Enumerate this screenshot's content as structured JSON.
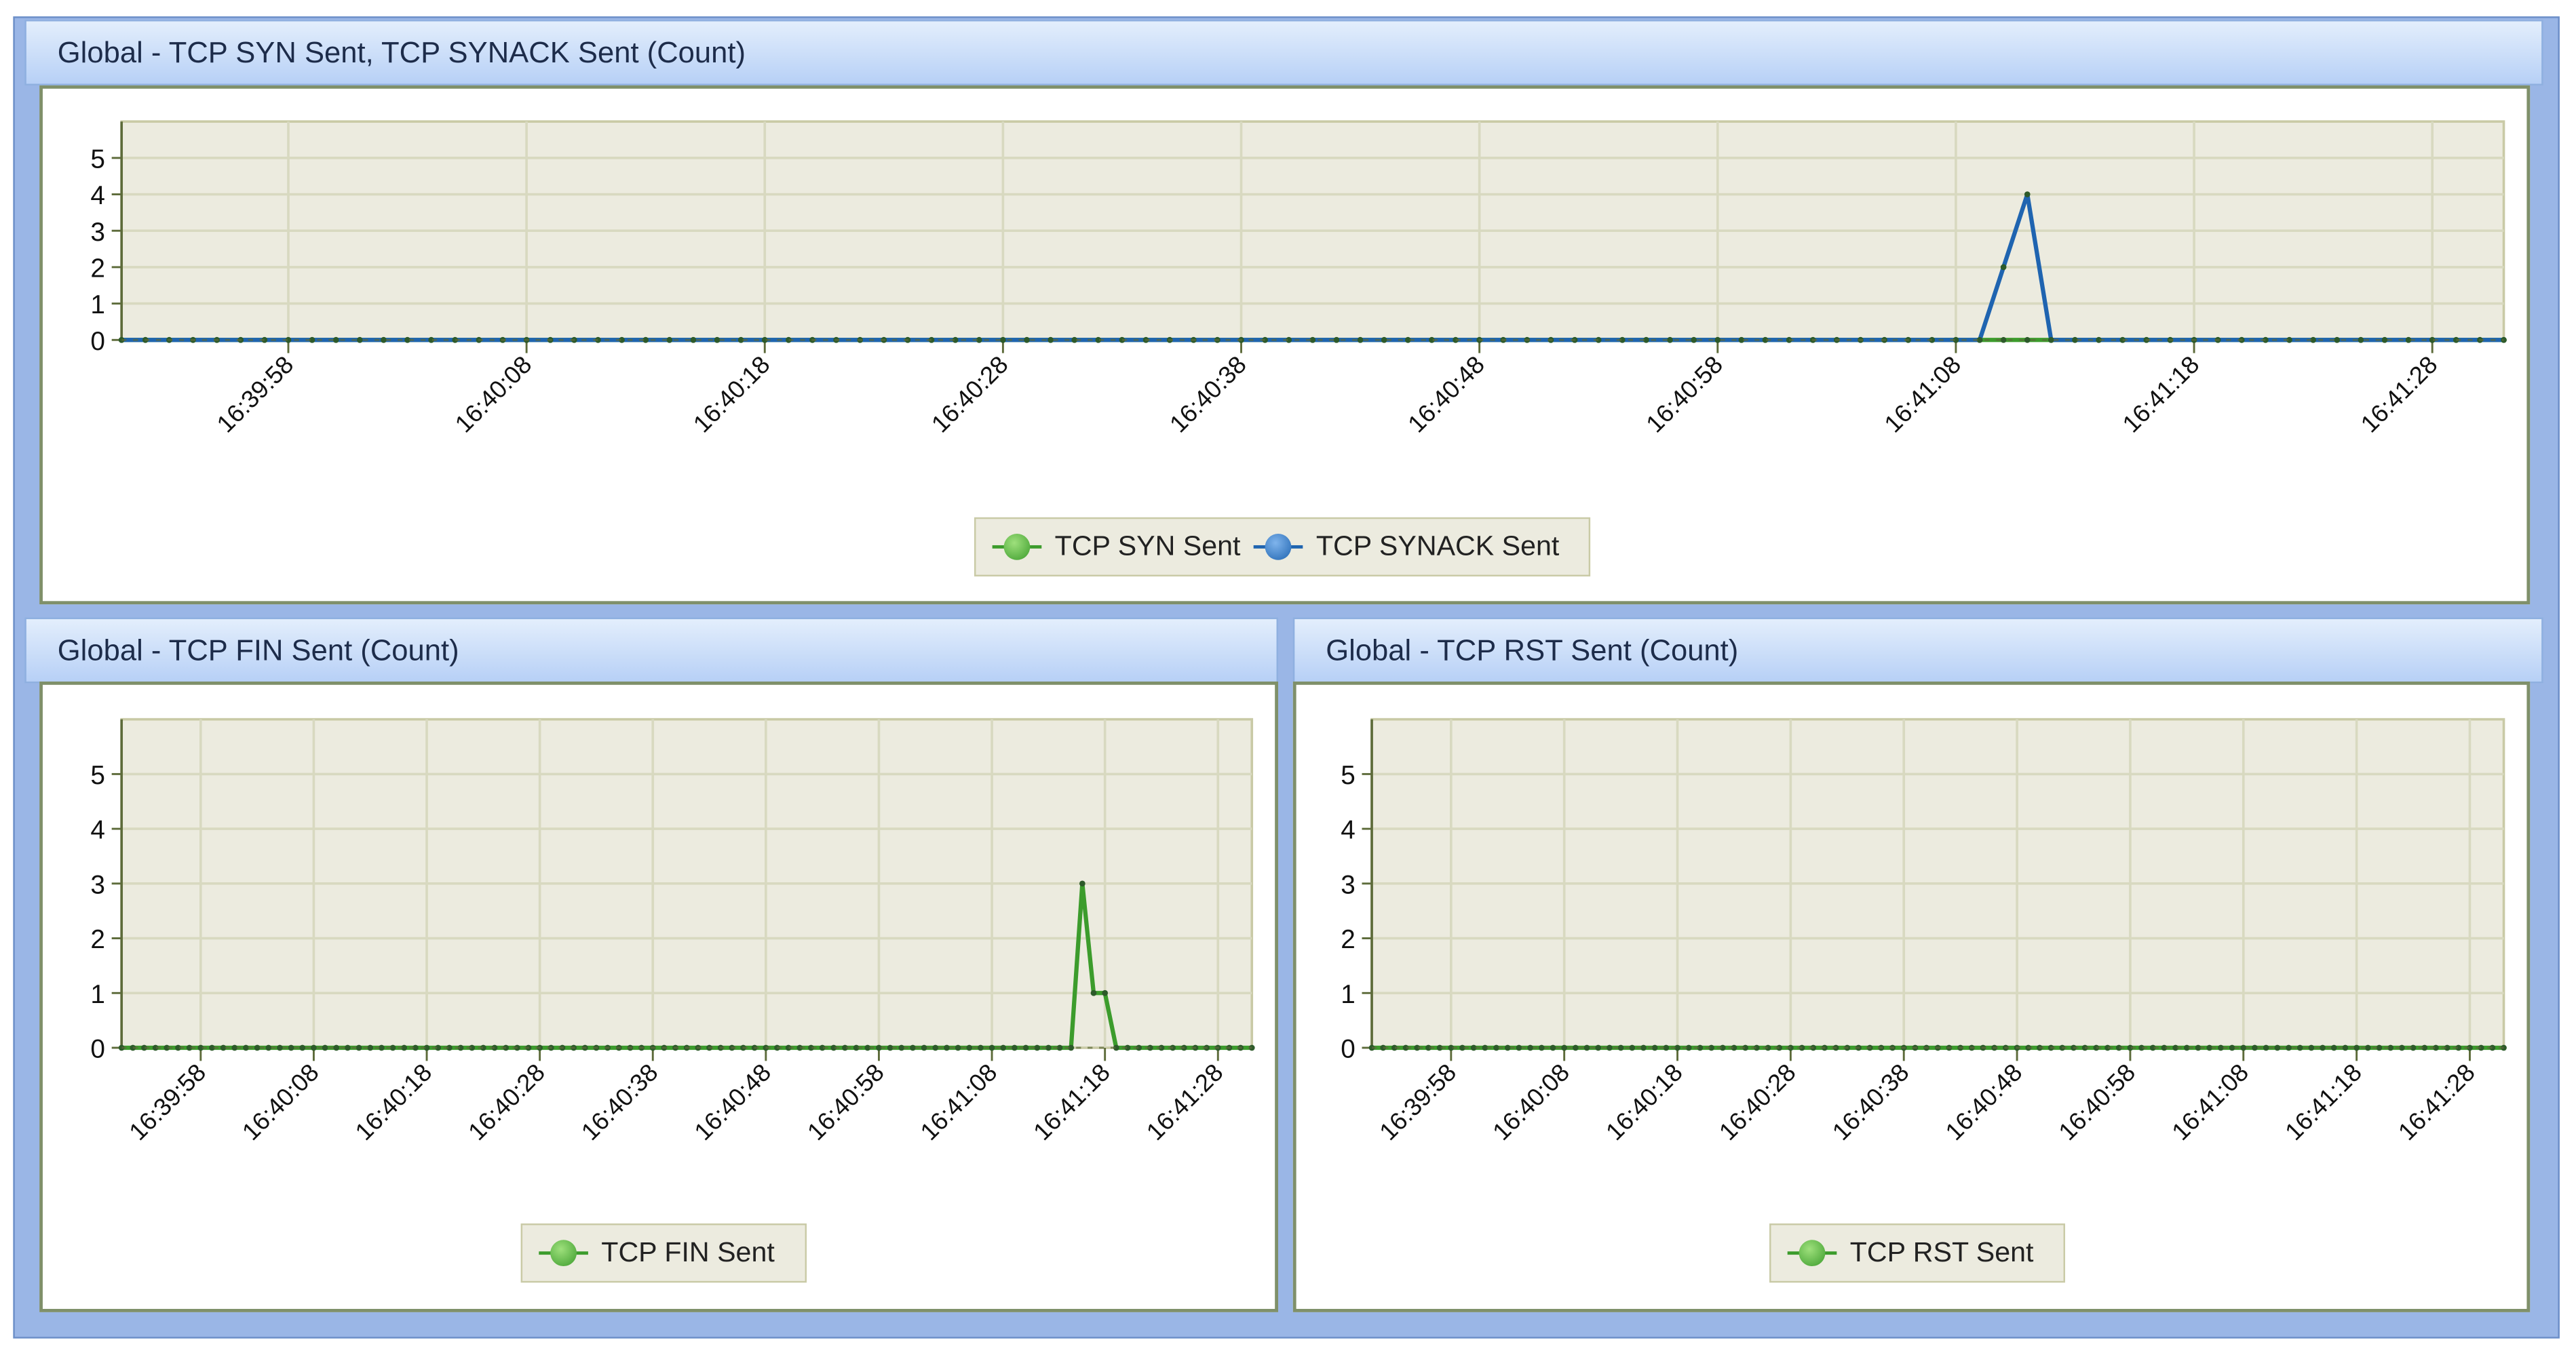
{
  "colors": {
    "green": "#3c9c2c",
    "blue": "#1f64b0",
    "plot_bg": "#ecebdf",
    "grid": "#d8d9c0",
    "axis": "#5d6b3a"
  },
  "chart_data": [
    {
      "type": "line",
      "title": "Global - TCP SYN Sent, TCP SYNACK Sent (Count)",
      "x_start": "16:39:51",
      "x_end": "16:41:31",
      "interval_s": 1,
      "xticks": [
        "16:39:58",
        "16:40:08",
        "16:40:18",
        "16:40:28",
        "16:40:38",
        "16:40:48",
        "16:40:58",
        "16:41:08",
        "16:41:18",
        "16:41:28"
      ],
      "yticks": [
        "0",
        "1",
        "2",
        "3",
        "4",
        "5"
      ],
      "ylim": [
        0,
        6
      ],
      "legend": "bottom-center",
      "series": [
        {
          "name": "TCP SYN Sent",
          "color": "#3c9c2c",
          "values": [
            0,
            0,
            0,
            0,
            0,
            0,
            0,
            0,
            0,
            0,
            0,
            0,
            0,
            0,
            0,
            0,
            0,
            0,
            0,
            0,
            0,
            0,
            0,
            0,
            0,
            0,
            0,
            0,
            0,
            0,
            0,
            0,
            0,
            0,
            0,
            0,
            0,
            0,
            0,
            0,
            0,
            0,
            0,
            0,
            0,
            0,
            0,
            0,
            0,
            0,
            0,
            0,
            0,
            0,
            0,
            0,
            0,
            0,
            0,
            0,
            0,
            0,
            0,
            0,
            0,
            0,
            0,
            0,
            0,
            0,
            0,
            0,
            0,
            0,
            0,
            0,
            0,
            0,
            0,
            0,
            0,
            0,
            0,
            0,
            0,
            0,
            0,
            0,
            0,
            0,
            0,
            0,
            0,
            0,
            0,
            0,
            0,
            0,
            0,
            0,
            0
          ]
        },
        {
          "name": "TCP SYNACK Sent",
          "color": "#1f64b0",
          "values": [
            0,
            0,
            0,
            0,
            0,
            0,
            0,
            0,
            0,
            0,
            0,
            0,
            0,
            0,
            0,
            0,
            0,
            0,
            0,
            0,
            0,
            0,
            0,
            0,
            0,
            0,
            0,
            0,
            0,
            0,
            0,
            0,
            0,
            0,
            0,
            0,
            0,
            0,
            0,
            0,
            0,
            0,
            0,
            0,
            0,
            0,
            0,
            0,
            0,
            0,
            0,
            0,
            0,
            0,
            0,
            0,
            0,
            0,
            0,
            0,
            0,
            0,
            0,
            0,
            0,
            0,
            0,
            0,
            0,
            0,
            0,
            0,
            0,
            0,
            0,
            0,
            0,
            0,
            0,
            2,
            4,
            0,
            0,
            0,
            0,
            0,
            0,
            0,
            0,
            0,
            0,
            0,
            0,
            0,
            0,
            0,
            0,
            0,
            0,
            0,
            0
          ]
        }
      ]
    },
    {
      "type": "line",
      "title": "Global - TCP FIN Sent (Count)",
      "x_start": "16:39:51",
      "x_end": "16:41:31",
      "interval_s": 1,
      "xticks": [
        "16:39:58",
        "16:40:08",
        "16:40:18",
        "16:40:28",
        "16:40:38",
        "16:40:48",
        "16:40:58",
        "16:41:08",
        "16:41:18",
        "16:41:28"
      ],
      "yticks": [
        "0",
        "1",
        "2",
        "3",
        "4",
        "5"
      ],
      "ylim": [
        0,
        6
      ],
      "legend": "bottom-center",
      "series": [
        {
          "name": "TCP FIN Sent",
          "color": "#3c9c2c",
          "values": [
            0,
            0,
            0,
            0,
            0,
            0,
            0,
            0,
            0,
            0,
            0,
            0,
            0,
            0,
            0,
            0,
            0,
            0,
            0,
            0,
            0,
            0,
            0,
            0,
            0,
            0,
            0,
            0,
            0,
            0,
            0,
            0,
            0,
            0,
            0,
            0,
            0,
            0,
            0,
            0,
            0,
            0,
            0,
            0,
            0,
            0,
            0,
            0,
            0,
            0,
            0,
            0,
            0,
            0,
            0,
            0,
            0,
            0,
            0,
            0,
            0,
            0,
            0,
            0,
            0,
            0,
            0,
            0,
            0,
            0,
            0,
            0,
            0,
            0,
            0,
            0,
            0,
            0,
            0,
            0,
            0,
            0,
            0,
            0,
            0,
            3,
            1,
            1,
            0,
            0,
            0,
            0,
            0,
            0,
            0,
            0,
            0,
            0,
            0,
            0,
            0
          ]
        }
      ]
    },
    {
      "type": "line",
      "title": "Global - TCP RST Sent (Count)",
      "x_start": "16:39:51",
      "x_end": "16:41:31",
      "interval_s": 1,
      "xticks": [
        "16:39:58",
        "16:40:08",
        "16:40:18",
        "16:40:28",
        "16:40:38",
        "16:40:48",
        "16:40:58",
        "16:41:08",
        "16:41:18",
        "16:41:28"
      ],
      "yticks": [
        "0",
        "1",
        "2",
        "3",
        "4",
        "5"
      ],
      "ylim": [
        0,
        6
      ],
      "legend": "bottom-center",
      "series": [
        {
          "name": "TCP RST Sent",
          "color": "#3c9c2c",
          "values": [
            0,
            0,
            0,
            0,
            0,
            0,
            0,
            0,
            0,
            0,
            0,
            0,
            0,
            0,
            0,
            0,
            0,
            0,
            0,
            0,
            0,
            0,
            0,
            0,
            0,
            0,
            0,
            0,
            0,
            0,
            0,
            0,
            0,
            0,
            0,
            0,
            0,
            0,
            0,
            0,
            0,
            0,
            0,
            0,
            0,
            0,
            0,
            0,
            0,
            0,
            0,
            0,
            0,
            0,
            0,
            0,
            0,
            0,
            0,
            0,
            0,
            0,
            0,
            0,
            0,
            0,
            0,
            0,
            0,
            0,
            0,
            0,
            0,
            0,
            0,
            0,
            0,
            0,
            0,
            0,
            0,
            0,
            0,
            0,
            0,
            0,
            0,
            0,
            0,
            0,
            0,
            0,
            0,
            0,
            0,
            0,
            0,
            0,
            0,
            0,
            0
          ]
        }
      ]
    }
  ]
}
